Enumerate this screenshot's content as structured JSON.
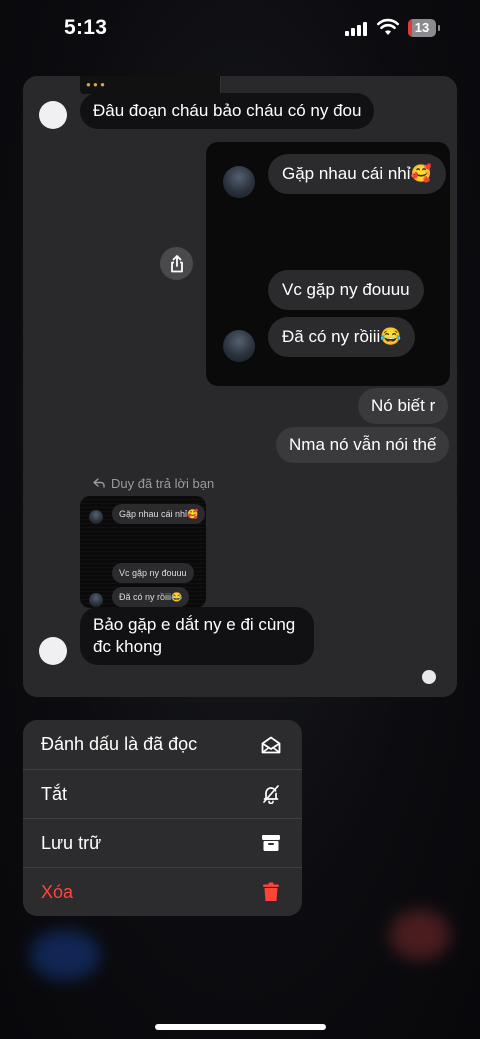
{
  "status_bar": {
    "time": "5:13",
    "battery_level": "13",
    "battery_color": "#e5383b"
  },
  "preview": {
    "messages": {
      "m1": "Đâu đoạn cháu bảo cháu có ny đou",
      "m2": "Nó biết r",
      "m3": "Nma nó vẫn nói thế",
      "m4": "Bảo gặp e dắt ny e đi cùng đc khong"
    },
    "shared_card": {
      "b1": "Gặp nhau cái nhỉ🥰",
      "b2": "Vc gặp ny đouuu",
      "b3": "Đã có ny rồiii😂"
    },
    "reply_label": "Duy đã trả lời bạn",
    "mini_card": {
      "b1": "Gặp nhau cái nhỉ🥰",
      "b2": "Vc gặp ny đouuu",
      "b3": "Đã có ny rồiii😂"
    }
  },
  "menu": {
    "items": [
      {
        "label": "Đánh dấu là đã đọc",
        "icon": "envelope-open-icon"
      },
      {
        "label": "Tắt",
        "icon": "bell-slash-icon"
      },
      {
        "label": "Lưu trữ",
        "icon": "archive-box-icon"
      },
      {
        "label": "Xóa",
        "icon": "trash-icon",
        "color": "#ff453a"
      }
    ]
  }
}
